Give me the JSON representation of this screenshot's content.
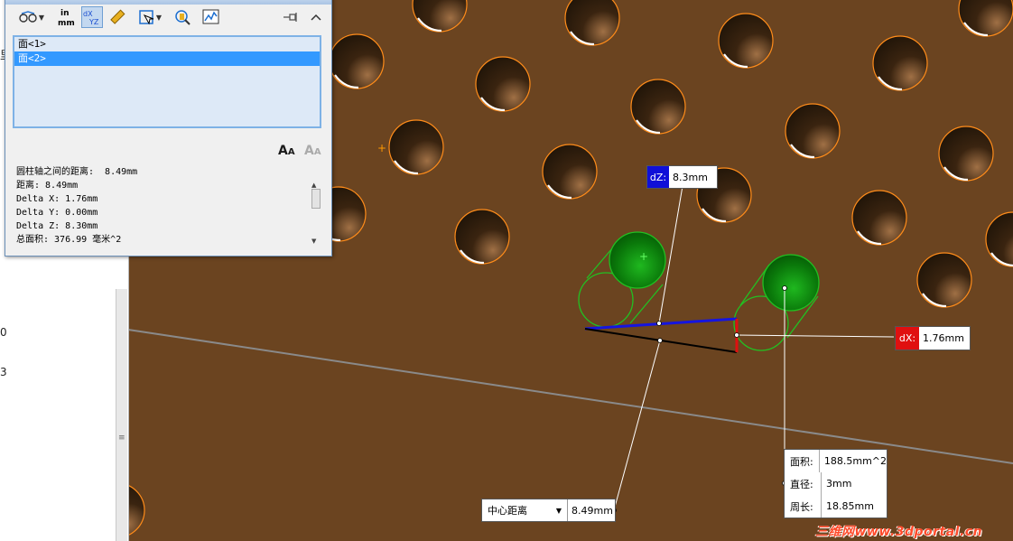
{
  "measure_window": {
    "toolbar_icons": [
      "arc-options-icon",
      "units-icon",
      "xyz-delta-icon",
      "point-to-point-icon",
      "projection-icon",
      "measure-history-icon",
      "sensor-icon",
      "graph-icon",
      "pin-icon",
      "collapse-icon"
    ],
    "selections": [
      "面<1>",
      "面<2>"
    ],
    "results": [
      "圆柱轴之间的距离:  8.49mm",
      "距离: 8.49mm",
      "Delta X: 1.76mm",
      "Delta Y: 0.00mm",
      "Delta Z: 8.30mm",
      "总面积: 376.99 毫米^2"
    ],
    "font_large_label": "A",
    "font_small_label": "A"
  },
  "left_panel": {
    "fragments": [
      "里",
      "0",
      "3"
    ]
  },
  "callouts": {
    "dz": {
      "label": "dZ:",
      "value": "8.3mm"
    },
    "dx": {
      "label": "dX:",
      "value": "1.76mm"
    },
    "center_distance": {
      "label": "中心距离",
      "value": "8.49mm"
    },
    "face_props": [
      {
        "label": "面积:",
        "value": "188.5mm^2"
      },
      {
        "label": "直径:",
        "value": "3mm"
      },
      {
        "label": "周长:",
        "value": "18.85mm"
      }
    ]
  },
  "watermark": "三维网www.3dportal.cn",
  "colors": {
    "background": "#6b4420",
    "hole_edge": "#ff8c1a",
    "selected_face": "#118811",
    "dz_blue": "#1010d8",
    "dx_red": "#e01010"
  }
}
